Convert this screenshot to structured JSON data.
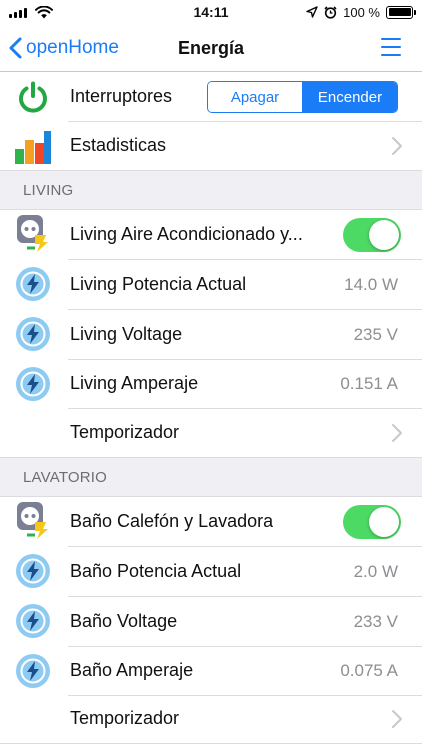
{
  "status": {
    "time": "14:11",
    "battery": "100 %"
  },
  "nav": {
    "back_label": "openHome",
    "title": "Energía"
  },
  "top": {
    "switches_label": "Interruptores",
    "off_label": "Apagar",
    "on_label": "Encender",
    "stats_label": "Estadisticas"
  },
  "sections": [
    {
      "header": "LIVING",
      "switch_label": "Living Aire Acondicionado y...",
      "switch_on": true,
      "readings": [
        {
          "label": "Living Potencia Actual",
          "value": "14.0 W"
        },
        {
          "label": "Living Voltage",
          "value": "235 V"
        },
        {
          "label": "Living Amperaje",
          "value": "0.151 A"
        }
      ],
      "timer_label": "Temporizador"
    },
    {
      "header": "LAVATORIO",
      "switch_label": "Baño Calefón y Lavadora",
      "switch_on": true,
      "readings": [
        {
          "label": "Baño Potencia Actual",
          "value": "2.0 W"
        },
        {
          "label": "Baño Voltage",
          "value": "233 V"
        },
        {
          "label": "Baño Amperaje",
          "value": "0.075 A"
        }
      ],
      "timer_label": "Temporizador"
    }
  ],
  "colors": {
    "accent": "#1b7cf7",
    "toggle_on": "#4cd964",
    "power_green": "#21a843",
    "bolt_circle": "#8ecbf2"
  }
}
